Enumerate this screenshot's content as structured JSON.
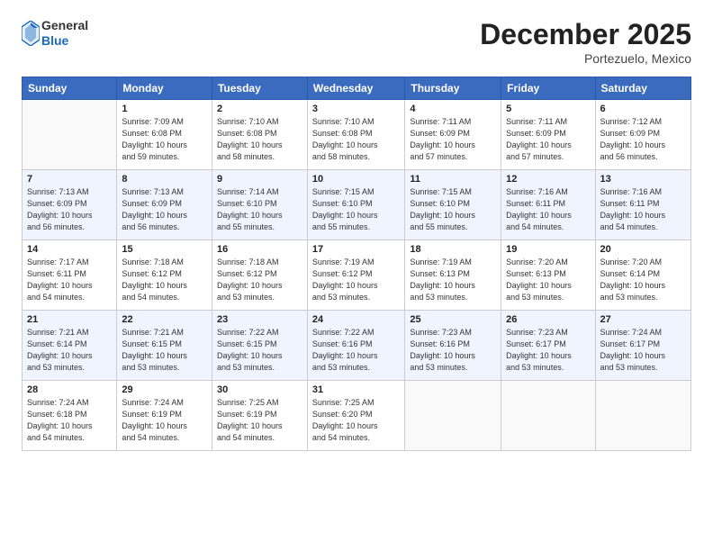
{
  "header": {
    "logo": {
      "general": "General",
      "blue": "Blue"
    },
    "title": "December 2025",
    "subtitle": "Portezuelo, Mexico"
  },
  "weekdays": [
    "Sunday",
    "Monday",
    "Tuesday",
    "Wednesday",
    "Thursday",
    "Friday",
    "Saturday"
  ],
  "weeks": [
    [
      {
        "day": "",
        "info": ""
      },
      {
        "day": "1",
        "info": "Sunrise: 7:09 AM\nSunset: 6:08 PM\nDaylight: 10 hours\nand 59 minutes."
      },
      {
        "day": "2",
        "info": "Sunrise: 7:10 AM\nSunset: 6:08 PM\nDaylight: 10 hours\nand 58 minutes."
      },
      {
        "day": "3",
        "info": "Sunrise: 7:10 AM\nSunset: 6:08 PM\nDaylight: 10 hours\nand 58 minutes."
      },
      {
        "day": "4",
        "info": "Sunrise: 7:11 AM\nSunset: 6:09 PM\nDaylight: 10 hours\nand 57 minutes."
      },
      {
        "day": "5",
        "info": "Sunrise: 7:11 AM\nSunset: 6:09 PM\nDaylight: 10 hours\nand 57 minutes."
      },
      {
        "day": "6",
        "info": "Sunrise: 7:12 AM\nSunset: 6:09 PM\nDaylight: 10 hours\nand 56 minutes."
      }
    ],
    [
      {
        "day": "7",
        "info": "Sunrise: 7:13 AM\nSunset: 6:09 PM\nDaylight: 10 hours\nand 56 minutes."
      },
      {
        "day": "8",
        "info": "Sunrise: 7:13 AM\nSunset: 6:09 PM\nDaylight: 10 hours\nand 56 minutes."
      },
      {
        "day": "9",
        "info": "Sunrise: 7:14 AM\nSunset: 6:10 PM\nDaylight: 10 hours\nand 55 minutes."
      },
      {
        "day": "10",
        "info": "Sunrise: 7:15 AM\nSunset: 6:10 PM\nDaylight: 10 hours\nand 55 minutes."
      },
      {
        "day": "11",
        "info": "Sunrise: 7:15 AM\nSunset: 6:10 PM\nDaylight: 10 hours\nand 55 minutes."
      },
      {
        "day": "12",
        "info": "Sunrise: 7:16 AM\nSunset: 6:11 PM\nDaylight: 10 hours\nand 54 minutes."
      },
      {
        "day": "13",
        "info": "Sunrise: 7:16 AM\nSunset: 6:11 PM\nDaylight: 10 hours\nand 54 minutes."
      }
    ],
    [
      {
        "day": "14",
        "info": "Sunrise: 7:17 AM\nSunset: 6:11 PM\nDaylight: 10 hours\nand 54 minutes."
      },
      {
        "day": "15",
        "info": "Sunrise: 7:18 AM\nSunset: 6:12 PM\nDaylight: 10 hours\nand 54 minutes."
      },
      {
        "day": "16",
        "info": "Sunrise: 7:18 AM\nSunset: 6:12 PM\nDaylight: 10 hours\nand 53 minutes."
      },
      {
        "day": "17",
        "info": "Sunrise: 7:19 AM\nSunset: 6:12 PM\nDaylight: 10 hours\nand 53 minutes."
      },
      {
        "day": "18",
        "info": "Sunrise: 7:19 AM\nSunset: 6:13 PM\nDaylight: 10 hours\nand 53 minutes."
      },
      {
        "day": "19",
        "info": "Sunrise: 7:20 AM\nSunset: 6:13 PM\nDaylight: 10 hours\nand 53 minutes."
      },
      {
        "day": "20",
        "info": "Sunrise: 7:20 AM\nSunset: 6:14 PM\nDaylight: 10 hours\nand 53 minutes."
      }
    ],
    [
      {
        "day": "21",
        "info": "Sunrise: 7:21 AM\nSunset: 6:14 PM\nDaylight: 10 hours\nand 53 minutes."
      },
      {
        "day": "22",
        "info": "Sunrise: 7:21 AM\nSunset: 6:15 PM\nDaylight: 10 hours\nand 53 minutes."
      },
      {
        "day": "23",
        "info": "Sunrise: 7:22 AM\nSunset: 6:15 PM\nDaylight: 10 hours\nand 53 minutes."
      },
      {
        "day": "24",
        "info": "Sunrise: 7:22 AM\nSunset: 6:16 PM\nDaylight: 10 hours\nand 53 minutes."
      },
      {
        "day": "25",
        "info": "Sunrise: 7:23 AM\nSunset: 6:16 PM\nDaylight: 10 hours\nand 53 minutes."
      },
      {
        "day": "26",
        "info": "Sunrise: 7:23 AM\nSunset: 6:17 PM\nDaylight: 10 hours\nand 53 minutes."
      },
      {
        "day": "27",
        "info": "Sunrise: 7:24 AM\nSunset: 6:17 PM\nDaylight: 10 hours\nand 53 minutes."
      }
    ],
    [
      {
        "day": "28",
        "info": "Sunrise: 7:24 AM\nSunset: 6:18 PM\nDaylight: 10 hours\nand 54 minutes."
      },
      {
        "day": "29",
        "info": "Sunrise: 7:24 AM\nSunset: 6:19 PM\nDaylight: 10 hours\nand 54 minutes."
      },
      {
        "day": "30",
        "info": "Sunrise: 7:25 AM\nSunset: 6:19 PM\nDaylight: 10 hours\nand 54 minutes."
      },
      {
        "day": "31",
        "info": "Sunrise: 7:25 AM\nSunset: 6:20 PM\nDaylight: 10 hours\nand 54 minutes."
      },
      {
        "day": "",
        "info": ""
      },
      {
        "day": "",
        "info": ""
      },
      {
        "day": "",
        "info": ""
      }
    ]
  ]
}
